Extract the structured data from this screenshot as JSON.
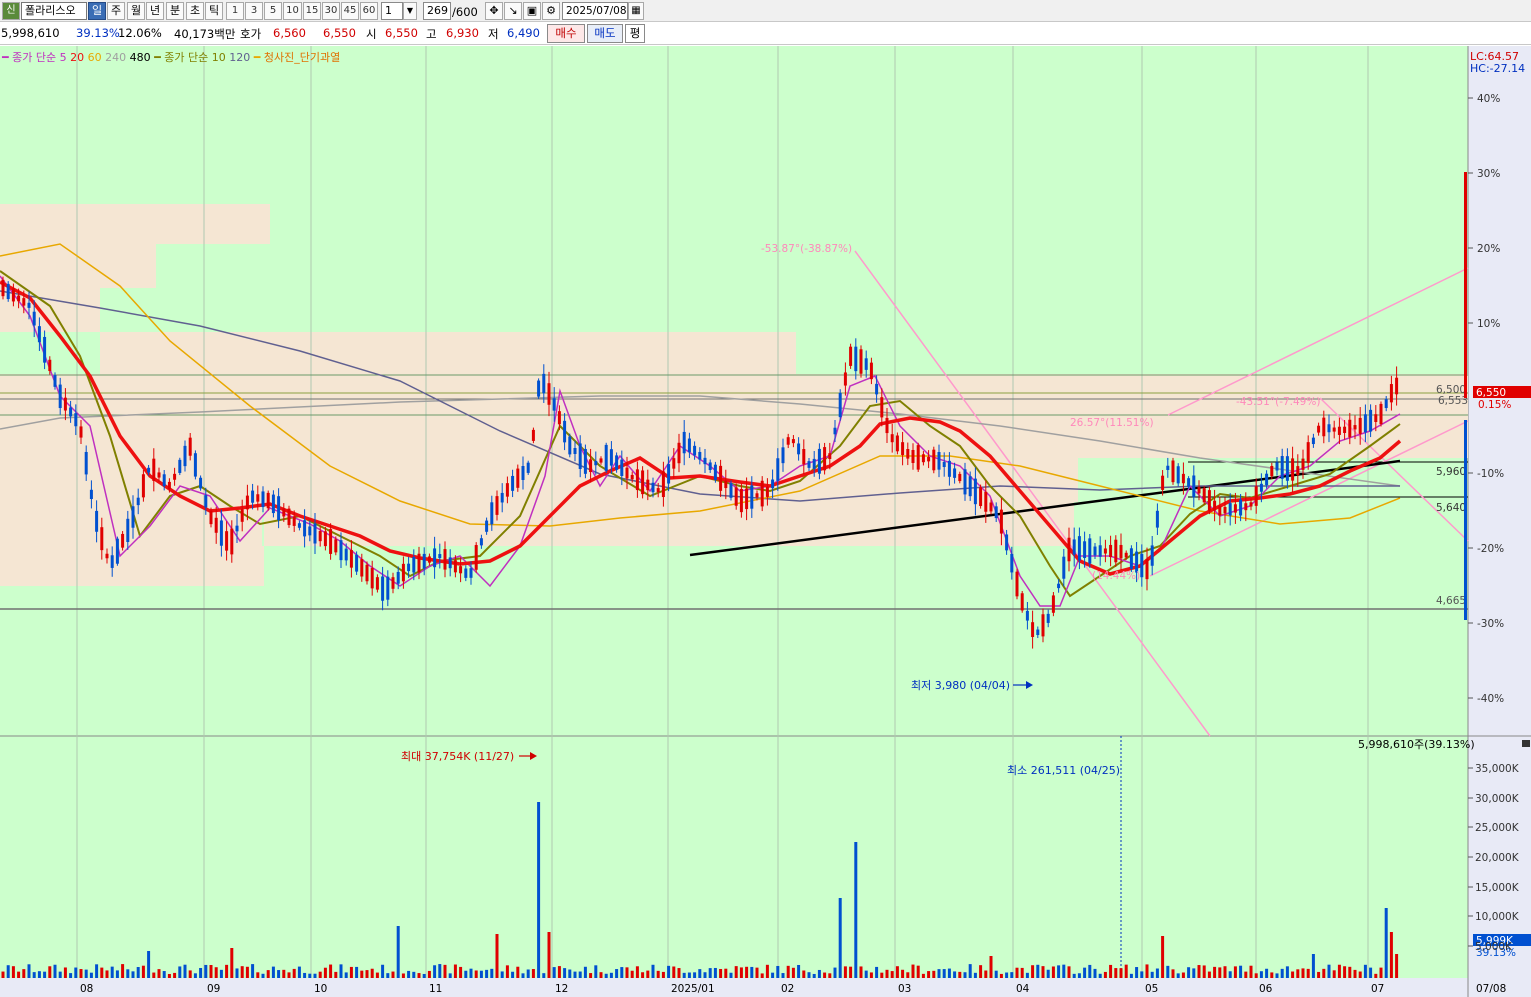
{
  "toolbar": {
    "stock_badge": "신",
    "stock_name": "폴라리스오",
    "period_buttons": [
      "일",
      "주",
      "월",
      "년",
      "분",
      "초",
      "틱"
    ],
    "active_period": "일",
    "interval_buttons": [
      "1",
      "3",
      "5",
      "10",
      "15",
      "30",
      "45",
      "60"
    ],
    "interval_value": "1",
    "count_value": "269",
    "count_max": "/600",
    "date_value": "2025/07/08"
  },
  "quote": {
    "volume": "5,998,610",
    "volume_ratio": "39.13%",
    "change_pct": "12.06%",
    "amount": "40,173백만",
    "bid_ask_label": "호가",
    "ask": "6,560",
    "bid": "6,550",
    "open_label": "시",
    "open": "6,550",
    "high_label": "고",
    "high": "6,930",
    "low_label": "저",
    "low": "6,490",
    "buy_label": "매수",
    "sell_label": "매도",
    "flat_label": "평"
  },
  "legend": {
    "ma_label": "종가 단순",
    "ma_short": [
      "5",
      "20",
      "60",
      "240",
      "480"
    ],
    "ma_long_label": "종가 단순",
    "ma_long": [
      "10",
      "120"
    ],
    "indicator": "청사진_단기과열"
  },
  "colors": {
    "chart_bg": "#ccffcc",
    "box_fill": "#f5e6d3",
    "up": "#e00000",
    "down": "#0050d0",
    "ma5": "#c030c0",
    "ma10": "#808000",
    "ma20": "#ee1111",
    "ma60": "#e8a800",
    "ma120": "#606090",
    "ma240": "#a0a0a0",
    "trend": "#ff99cc"
  },
  "price_axis": {
    "lc": "LC:64.57",
    "hc": "HC:-27.14",
    "pct_ticks": [
      "40%",
      "30%",
      "20%",
      "10%",
      "-10%",
      "-20%",
      "-30%",
      "-40%"
    ],
    "current_price": "6,550",
    "current_pct": "0.15%",
    "levels": [
      "6,500",
      "6,553",
      "5,960",
      "5,640",
      "4,665"
    ]
  },
  "annotations": {
    "min_price": "최저 3,980 (04/04)",
    "trend_up": "-53.87°(-38.87%)",
    "trend_mid": "26.57°(11.51%)",
    "trend_right": "-43.51°(-7.49%)",
    "trend_low": "(14.44%)",
    "max_volume": "최대 37,754K (11/27)",
    "min_volume": "최소 261,511 (04/25)",
    "volume_total": "5,998,610주(39.13%)"
  },
  "volume_axis": {
    "ticks": [
      "35,000K",
      "30,000K",
      "25,000K",
      "20,000K",
      "15,000K",
      "10,000K",
      "5,000K"
    ],
    "current": "5,999K",
    "current_pct": "39.13%"
  },
  "date_axis": {
    "labels": [
      "08",
      "09",
      "10",
      "11",
      "12",
      "2025/01",
      "02",
      "03",
      "04",
      "05",
      "06",
      "07",
      "07/08"
    ]
  }
}
